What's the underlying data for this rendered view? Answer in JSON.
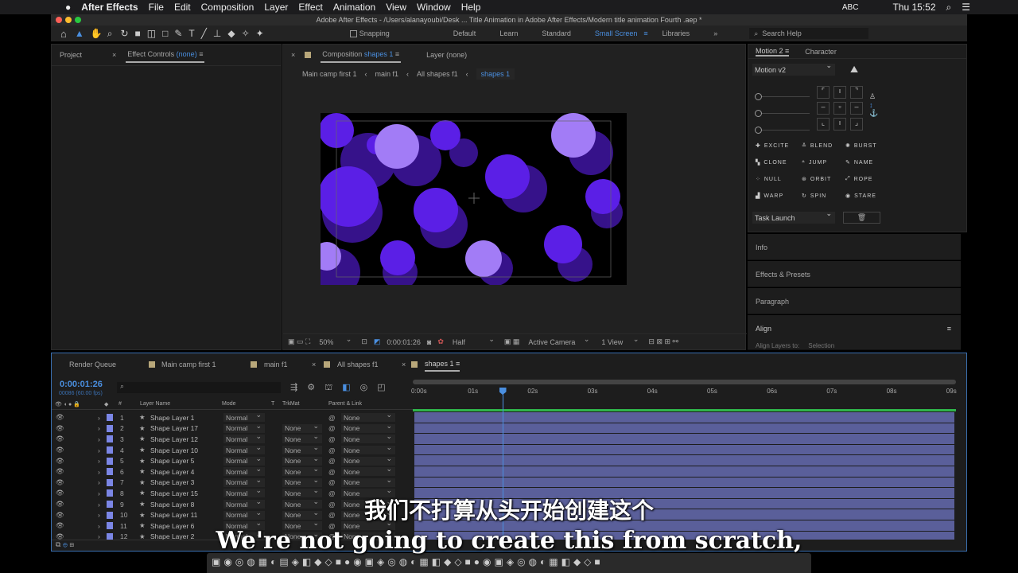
{
  "menubar": {
    "app": "After Effects",
    "items": [
      "File",
      "Edit",
      "Composition",
      "Layer",
      "Effect",
      "Animation",
      "View",
      "Window",
      "Help"
    ],
    "input_label": "ABC",
    "clock": "Thu 15:52"
  },
  "window_title": "Adobe After Effects - /Users/alanayoubi/Desk ... Title Animation in Adobe After Effects/Modern title animation Fourth .aep *",
  "toolbar": {
    "snapping": "Snapping",
    "workspaces": [
      "Default",
      "Learn",
      "Standard",
      "Small Screen",
      "Libraries"
    ],
    "active_workspace": "Small Screen",
    "search_placeholder": "Search Help"
  },
  "left_panel": {
    "tab_project": "Project",
    "tab_effect_controls": "Effect Controls",
    "effect_target": "(none)"
  },
  "comp_panel": {
    "tab_label": "Composition",
    "comp_name": "shapes 1",
    "layer_tab": "Layer (none)",
    "breadcrumbs": [
      "Main camp first 1",
      "main f1",
      "All shapes f1",
      "shapes 1"
    ],
    "footer": {
      "zoom": "50%",
      "timecode": "0:00:01:26",
      "resolution": "Half",
      "camera": "Active Camera",
      "views": "1 View"
    }
  },
  "motion_panel": {
    "tab": "Motion 2",
    "tab2": "Character",
    "preset": "Motion v2",
    "buttons": [
      "EXCITE",
      "BLEND",
      "BURST",
      "CLONE",
      "JUMP",
      "NAME",
      "NULL",
      "ORBIT",
      "ROPE",
      "WARP",
      "SPIN",
      "STARE"
    ],
    "task": "Task Launch"
  },
  "right_sections": [
    "Info",
    "Effects & Presets",
    "Paragraph",
    "Align"
  ],
  "align": {
    "label": "Align Layers to:",
    "value": "Selection"
  },
  "timeline": {
    "tabs": [
      "Render Queue",
      "Main camp first 1",
      "main f1",
      "All shapes f1",
      "shapes 1"
    ],
    "active_tab": "shapes 1",
    "timecode": "0:00:01:26",
    "frames": "00086 (60.00 fps)",
    "columns": [
      "#",
      "Layer Name",
      "Mode",
      "T",
      "TrkMat",
      "Parent & Link"
    ],
    "ruler": [
      "0:00s",
      "01s",
      "02s",
      "03s",
      "04s",
      "05s",
      "06s",
      "07s",
      "08s",
      "09s"
    ],
    "playhead_seconds": 1.43,
    "layers": [
      {
        "n": "1",
        "name": "Shape Layer 1",
        "mode": "Normal",
        "trkmat": "",
        "parent": "None"
      },
      {
        "n": "2",
        "name": "Shape Layer 17",
        "mode": "Normal",
        "trkmat": "None",
        "parent": "None"
      },
      {
        "n": "3",
        "name": "Shape Layer 12",
        "mode": "Normal",
        "trkmat": "None",
        "parent": "None"
      },
      {
        "n": "4",
        "name": "Shape Layer 10",
        "mode": "Normal",
        "trkmat": "None",
        "parent": "None"
      },
      {
        "n": "5",
        "name": "Shape Layer 5",
        "mode": "Normal",
        "trkmat": "None",
        "parent": "None"
      },
      {
        "n": "6",
        "name": "Shape Layer 4",
        "mode": "Normal",
        "trkmat": "None",
        "parent": "None"
      },
      {
        "n": "7",
        "name": "Shape Layer 3",
        "mode": "Normal",
        "trkmat": "None",
        "parent": "None"
      },
      {
        "n": "8",
        "name": "Shape Layer 15",
        "mode": "Normal",
        "trkmat": "None",
        "parent": "None"
      },
      {
        "n": "9",
        "name": "Shape Layer 8",
        "mode": "Normal",
        "trkmat": "None",
        "parent": "None"
      },
      {
        "n": "10",
        "name": "Shape Layer 11",
        "mode": "Normal",
        "trkmat": "None",
        "parent": "None"
      },
      {
        "n": "11",
        "name": "Shape Layer 6",
        "mode": "Normal",
        "trkmat": "None",
        "parent": "None"
      },
      {
        "n": "12",
        "name": "Shape Layer 2",
        "mode": "Normal",
        "trkmat": "None",
        "parent": "None"
      }
    ],
    "label_color": "#7b86e6",
    "bar_color": "#5a5f9a"
  },
  "subtitles": {
    "zh": "我们不打算从头开始创建这个",
    "en": "We're not going to create this from scratch,"
  },
  "colors": {
    "accent": "#4a8fe0",
    "circle_dark": "#5b1fe6",
    "circle_light": "#a27cf6"
  }
}
